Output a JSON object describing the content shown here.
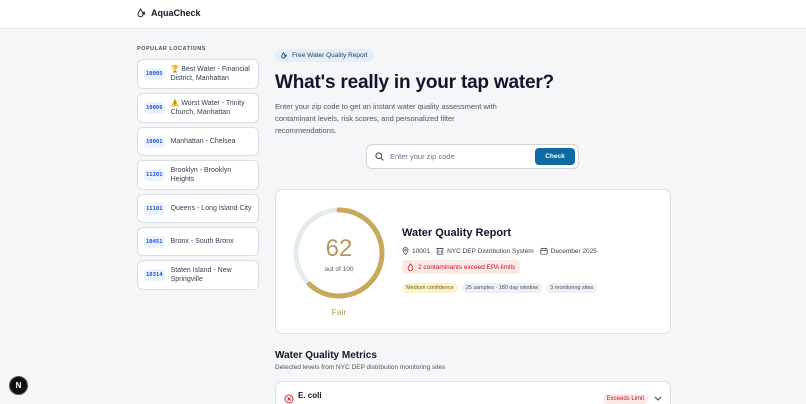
{
  "app": {
    "name": "AquaCheck"
  },
  "sidebar": {
    "heading": "POPULAR LOCATIONS",
    "items": [
      {
        "zip": "10005",
        "emoji": "🏆",
        "label": "Best Water - Financial District, Manhattan"
      },
      {
        "zip": "10006",
        "emoji": "⚠️",
        "label": "Worst Water - Trinity Church, Manhattan"
      },
      {
        "zip": "10001",
        "emoji": "",
        "label": "Manhattan - Chelsea"
      },
      {
        "zip": "11201",
        "emoji": "",
        "label": "Brooklyn - Brooklyn Heights"
      },
      {
        "zip": "11101",
        "emoji": "",
        "label": "Queens - Long Island City"
      },
      {
        "zip": "10451",
        "emoji": "",
        "label": "Bronx - South Bronx"
      },
      {
        "zip": "10314",
        "emoji": "",
        "label": "Staten Island - New Springville"
      }
    ]
  },
  "hero": {
    "pill": "Free Water Quality Report",
    "title": "What's really in your tap water?",
    "description": "Enter your zip code to get an instant water quality assessment with contaminant levels, risk scores, and personalized filter recommendations."
  },
  "search": {
    "placeholder": "Enter your zip code",
    "value": "",
    "button": "Check"
  },
  "report": {
    "score": 62,
    "score_max": 100,
    "score_sub": "out of 100",
    "rating": "Fair",
    "title": "Water Quality Report",
    "zip": "10001",
    "system": "NYC DEP Distribution System",
    "date": "December 2025",
    "warning": "2 contaminants exceed EPA limits",
    "tags": {
      "confidence": "Medium confidence",
      "samples": "25 samples · 180 day window",
      "sites": "3 monitoring sites"
    }
  },
  "metrics": {
    "title": "Water Quality Metrics",
    "subtitle": "Detected levels from NYC DEP distribution monitoring sites",
    "first": {
      "name": "E. coli",
      "badge": "Exceeds Limit"
    }
  },
  "fab": {
    "label": "N"
  },
  "colors": {
    "accent": "#0e6aa3",
    "gauge": "#c9a85c",
    "gauge_track": "#e4ebef",
    "danger": "#b91c1c"
  }
}
